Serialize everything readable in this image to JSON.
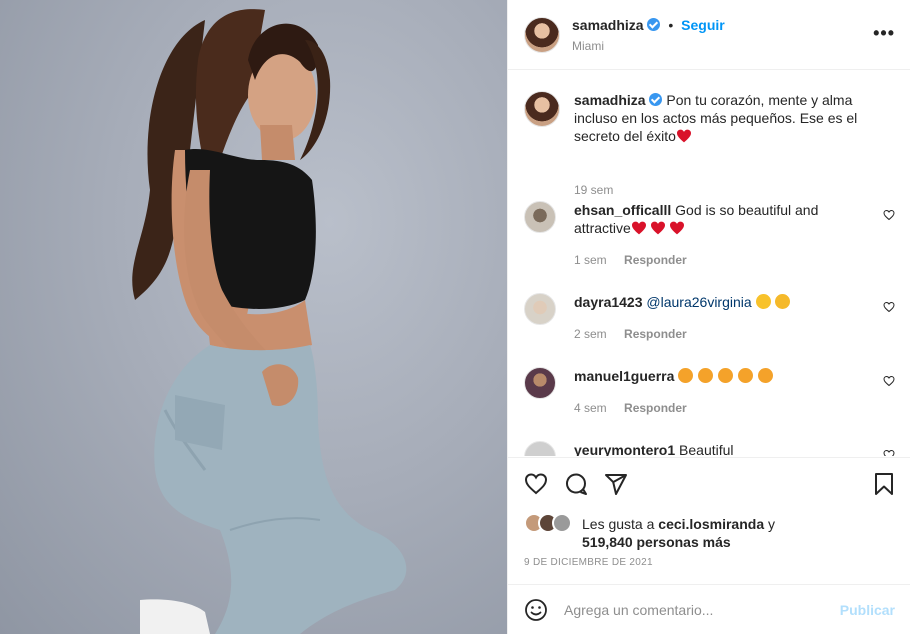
{
  "post": {
    "username": "samadhiza",
    "follow_label": "Seguir",
    "separator": "•",
    "location": "Miami",
    "more_label": "•••"
  },
  "caption": {
    "username": "samadhiza",
    "text": "Pon tu corazón, mente y alma incluso en los actos más pequeños. Ese es el secreto del éxito",
    "time": "19 sem"
  },
  "comments": [
    {
      "username": "ehsan_officalll",
      "text": "God is so beautiful and attractive",
      "emojis": [
        "red-heart",
        "red-heart",
        "red-heart"
      ],
      "time": "1 sem",
      "reply_label": "Responder"
    },
    {
      "username": "dayra1423",
      "mention": "@laura26virginia",
      "text": "",
      "emojis": [
        "grinning-face",
        "smiling-face-with-hearts"
      ],
      "time": "2 sem",
      "reply_label": "Responder"
    },
    {
      "username": "manuel1guerra",
      "text": "",
      "emojis": [
        "star-struck",
        "star-struck",
        "star-struck",
        "star-struck",
        "star-struck"
      ],
      "time": "4 sem",
      "reply_label": "Responder"
    },
    {
      "username": "yeurymontero1",
      "text": "Beautiful"
    }
  ],
  "likes": {
    "prefix": "Les gusta a",
    "first_user": "ceci.losmiranda",
    "conj": "y",
    "count_text": "519,840 personas más"
  },
  "date": "9 DE DICIEMBRE DE 2021",
  "add_comment": {
    "placeholder": "Agrega un comentario...",
    "publish_label": "Publicar"
  },
  "icons": {
    "like": "heart-outline-icon",
    "comment": "comment-bubble-icon",
    "share": "paper-plane-icon",
    "save": "bookmark-icon",
    "emoji": "emoji-smile-icon"
  },
  "colors": {
    "link_blue": "#0095f6",
    "verified_blue": "#3897f0",
    "muted": "#8e8e8e",
    "publish_disabled": "#b2dffc",
    "heart_red": "#e0245e"
  }
}
